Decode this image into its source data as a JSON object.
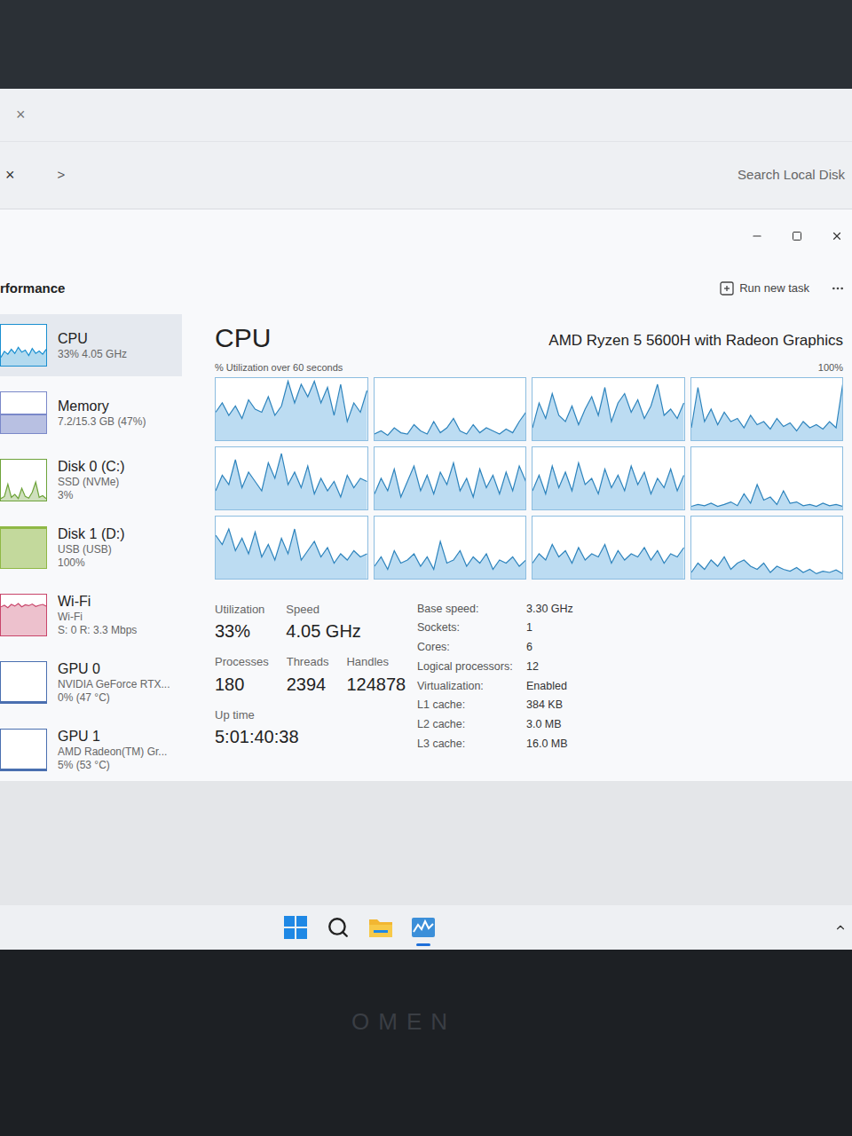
{
  "explorer": {
    "tab_close": "×",
    "side_close": "×",
    "breadcrumb": ">",
    "search": {
      "placeholder": "Search Local Disk"
    }
  },
  "window": {
    "header": "rformance",
    "run_task": "Run new task"
  },
  "sidebar": {
    "items": [
      {
        "name": "CPU",
        "sub": "33% 4.05 GHz",
        "value": "",
        "selected": true,
        "color": "#1a8fd0",
        "kind": "series",
        "values": [
          20,
          35,
          28,
          40,
          30,
          45,
          33,
          38,
          25,
          42,
          30,
          36,
          28,
          40
        ]
      },
      {
        "name": "Memory",
        "sub": "7.2/15.3 GB (47%)",
        "value": "",
        "selected": false,
        "color": "#7a88c9",
        "kind": "level",
        "level": 0.47
      },
      {
        "name": "Disk 0 (C:)",
        "sub": "SSD (NVMe)",
        "value": "3%",
        "selected": false,
        "color": "#6ea33a",
        "kind": "series",
        "values": [
          5,
          10,
          40,
          8,
          15,
          5,
          30,
          10,
          6,
          20,
          45,
          8,
          12,
          5
        ]
      },
      {
        "name": "Disk 1 (D:)",
        "sub": "USB (USB)",
        "value": "100%",
        "selected": false,
        "color": "#8fb845",
        "kind": "level",
        "level": 1
      },
      {
        "name": "Wi-Fi",
        "sub": "Wi-Fi",
        "value": "S: 0 R: 3.3 Mbps",
        "selected": false,
        "color": "#c9456a",
        "kind": "series",
        "values": [
          70,
          74,
          68,
          76,
          72,
          78,
          70,
          75,
          73,
          77,
          71,
          74,
          76,
          72
        ]
      },
      {
        "name": "GPU 0",
        "sub": "NVIDIA GeForce RTX...",
        "value": "0% (47 °C)",
        "selected": false,
        "color": "#4a6fb0",
        "kind": "level",
        "level": 0
      },
      {
        "name": "GPU 1",
        "sub": "AMD Radeon(TM) Gr...",
        "value": "5% (53 °C)",
        "selected": false,
        "color": "#4a6fb0",
        "kind": "level",
        "level": 0.05
      }
    ]
  },
  "cpu": {
    "title": "CPU",
    "model": "AMD Ryzen 5 5600H with Radeon Graphics",
    "caption": "% Utilization over 60 seconds",
    "max": "100%",
    "cores": [
      [
        45,
        60,
        40,
        55,
        35,
        65,
        50,
        45,
        70,
        40,
        55,
        95,
        60,
        90,
        70,
        95,
        60,
        85,
        40,
        90,
        30,
        60,
        45,
        80
      ],
      [
        10,
        15,
        8,
        20,
        12,
        10,
        25,
        15,
        10,
        30,
        12,
        20,
        35,
        15,
        10,
        25,
        12,
        20,
        15,
        10,
        18,
        12,
        30,
        45
      ],
      [
        20,
        60,
        35,
        75,
        40,
        30,
        55,
        25,
        50,
        70,
        40,
        85,
        30,
        60,
        75,
        45,
        65,
        35,
        55,
        90,
        40,
        50,
        35,
        60
      ],
      [
        20,
        85,
        30,
        50,
        25,
        45,
        30,
        35,
        20,
        40,
        25,
        30,
        18,
        35,
        22,
        28,
        15,
        30,
        20,
        25,
        18,
        30,
        20,
        90
      ],
      [
        30,
        55,
        40,
        80,
        35,
        60,
        45,
        30,
        75,
        50,
        90,
        40,
        60,
        35,
        70,
        25,
        50,
        30,
        45,
        20,
        55,
        35,
        50,
        45
      ],
      [
        25,
        50,
        30,
        65,
        20,
        45,
        70,
        30,
        55,
        25,
        60,
        40,
        75,
        30,
        50,
        20,
        65,
        35,
        55,
        25,
        60,
        30,
        70,
        45
      ],
      [
        30,
        55,
        25,
        70,
        35,
        60,
        30,
        75,
        40,
        50,
        25,
        65,
        35,
        55,
        30,
        70,
        40,
        60,
        25,
        50,
        35,
        65,
        30,
        55
      ],
      [
        5,
        8,
        6,
        10,
        5,
        8,
        12,
        6,
        25,
        10,
        40,
        15,
        20,
        8,
        30,
        10,
        12,
        6,
        8,
        5,
        10,
        6,
        8,
        5
      ],
      [
        70,
        55,
        80,
        45,
        65,
        40,
        75,
        35,
        55,
        30,
        65,
        40,
        80,
        30,
        45,
        60,
        35,
        50,
        25,
        40,
        30,
        45,
        35,
        40
      ],
      [
        20,
        35,
        15,
        45,
        25,
        30,
        40,
        20,
        35,
        15,
        60,
        25,
        30,
        45,
        20,
        35,
        25,
        40,
        15,
        30,
        25,
        35,
        20,
        30
      ],
      [
        25,
        40,
        30,
        55,
        35,
        45,
        25,
        50,
        30,
        40,
        35,
        55,
        25,
        45,
        30,
        40,
        35,
        50,
        30,
        45,
        25,
        40,
        35,
        50
      ],
      [
        10,
        25,
        15,
        30,
        20,
        35,
        15,
        25,
        30,
        20,
        15,
        25,
        10,
        20,
        15,
        12,
        18,
        10,
        15,
        8,
        12,
        10,
        14,
        8
      ]
    ],
    "stats": [
      {
        "label": "Utilization",
        "value": "33%"
      },
      {
        "label": "Speed",
        "value": "4.05 GHz"
      },
      {
        "label": "Processes",
        "value": "180"
      },
      {
        "label": "Threads",
        "value": "2394"
      },
      {
        "label": "Handles",
        "value": "124878"
      },
      {
        "label": "Up time",
        "value": "5:01:40:38"
      }
    ],
    "specs": [
      {
        "label": "Base speed:",
        "value": "3.30 GHz"
      },
      {
        "label": "Sockets:",
        "value": "1"
      },
      {
        "label": "Cores:",
        "value": "6"
      },
      {
        "label": "Logical processors:",
        "value": "12"
      },
      {
        "label": "Virtualization:",
        "value": "Enabled"
      },
      {
        "label": "L1 cache:",
        "value": "384 KB"
      },
      {
        "label": "L2 cache:",
        "value": "3.0 MB"
      },
      {
        "label": "L3 cache:",
        "value": "16.0 MB"
      }
    ]
  },
  "taskbar": {
    "apps": [
      {
        "kind": "start",
        "selected": false
      },
      {
        "kind": "search",
        "selected": false
      },
      {
        "kind": "explorer",
        "selected": false
      },
      {
        "kind": "taskmanager",
        "selected": true
      }
    ]
  },
  "laptop": {
    "brand": "OMEN"
  }
}
